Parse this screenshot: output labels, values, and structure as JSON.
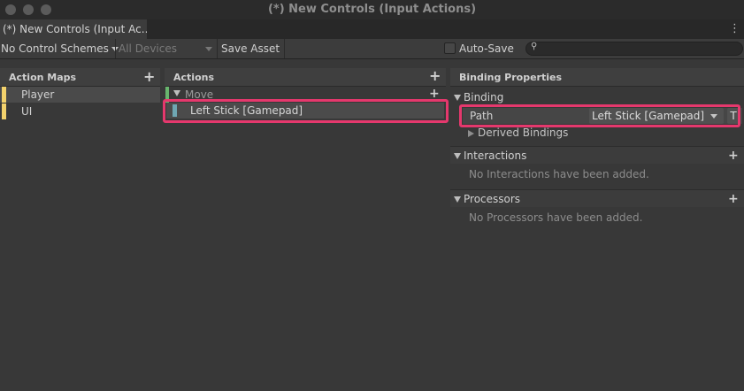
{
  "window": {
    "title": "(*) New Controls (Input Actions)"
  },
  "tab": {
    "label": "(*) New Controls (Input Ac..."
  },
  "toolbar": {
    "control_schemes": "No Control Schemes",
    "devices": "All Devices",
    "save_asset": "Save Asset",
    "auto_save": "Auto-Save",
    "search_value": ""
  },
  "action_maps": {
    "header": "Action Maps",
    "items": [
      {
        "label": "Player",
        "selected": true
      },
      {
        "label": "UI",
        "selected": false
      }
    ]
  },
  "actions": {
    "header": "Actions",
    "action": "Move",
    "binding": "Left Stick [Gamepad]"
  },
  "binding_properties": {
    "header": "Binding Properties",
    "binding_section": "Binding",
    "path_label": "Path",
    "path_value": "Left Stick [Gamepad]",
    "t_button": "T",
    "derived_bindings": "Derived Bindings",
    "interactions_section": "Interactions",
    "interactions_empty": "No Interactions have been added.",
    "processors_section": "Processors",
    "processors_empty": "No Processors have been added."
  },
  "colors": {
    "highlight": "#e5386d",
    "action_map_color": "#f3d26c",
    "action_color": "#68b56d",
    "binding_color": "#6fa7b3"
  }
}
